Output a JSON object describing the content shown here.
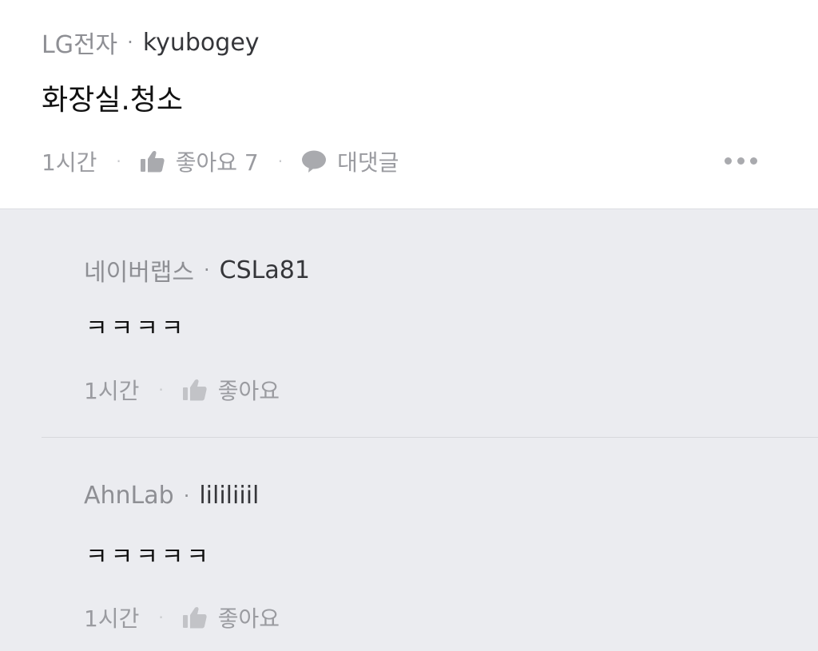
{
  "post": {
    "company": "LG전자",
    "separator": "·",
    "author": "kyubogey",
    "text": "화장실.청소",
    "time": "1시간",
    "like_label": "좋아요 7",
    "comment_label": "대댓글",
    "action_separator": "·"
  },
  "replies": [
    {
      "company": "네이버랩스",
      "separator": "·",
      "author": "CSLa81",
      "text": "ㅋㅋㅋㅋ",
      "time": "1시간",
      "like_label": "좋아요",
      "action_separator": "·"
    },
    {
      "company": "AhnLab",
      "separator": "·",
      "author": "lililiiil",
      "text": "ㅋㅋㅋㅋㅋ",
      "time": "1시간",
      "like_label": "좋아요",
      "action_separator": "·"
    }
  ],
  "icons": {
    "like": "thumbs-up-icon",
    "comment": "speech-bubble-icon",
    "more": "more-dots-icon"
  },
  "colors": {
    "reply_background": "#ebecf0",
    "muted_text": "#9a9ba0",
    "author_text": "#35363a"
  }
}
